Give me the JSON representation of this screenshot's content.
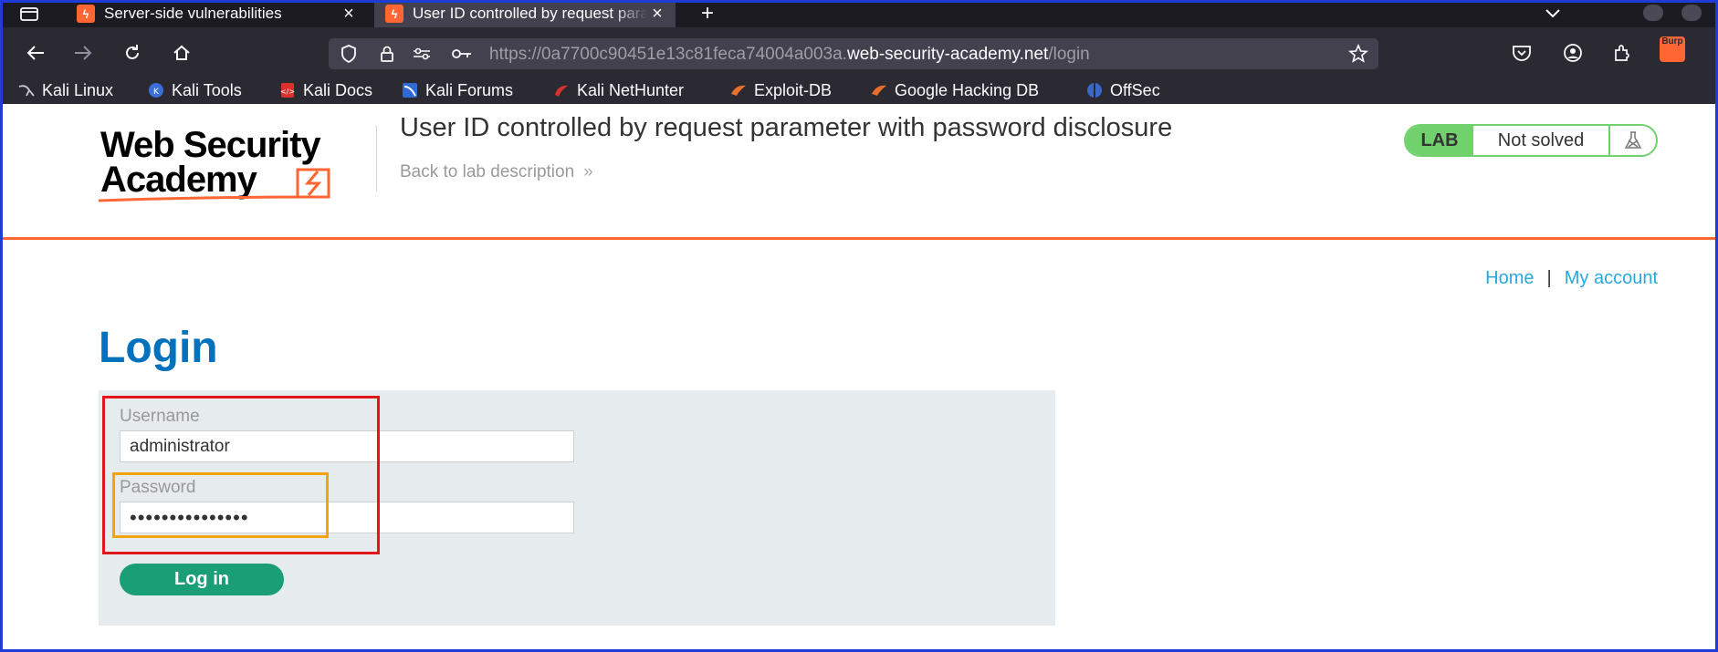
{
  "browser": {
    "tabs": [
      {
        "title": "Server-side vulnerabilities",
        "active": false
      },
      {
        "title": "User ID controlled by request parameter with password disclosure",
        "active": true
      }
    ],
    "url": {
      "prefix": "https://0a7700c90451e13c81feca74004a003a.",
      "host": "web-security-academy.net",
      "path": "/login"
    },
    "burp_label": "Burp",
    "bookmarks": [
      {
        "label": "Kali Linux",
        "icon": "kali-icon"
      },
      {
        "label": "Kali Tools",
        "icon": "kali-tools-icon"
      },
      {
        "label": "Kali Docs",
        "icon": "kali-docs-icon"
      },
      {
        "label": "Kali Forums",
        "icon": "kali-forums-icon"
      },
      {
        "label": "Kali NetHunter",
        "icon": "nethunter-icon"
      },
      {
        "label": "Exploit-DB",
        "icon": "exploit-db-icon"
      },
      {
        "label": "Google Hacking DB",
        "icon": "ghdb-icon"
      },
      {
        "label": "OffSec",
        "icon": "offsec-icon"
      }
    ]
  },
  "lab": {
    "logo_line1": "Web Security",
    "logo_line2": "Academy",
    "title": "User ID controlled by request parameter with password disclosure",
    "back_link": "Back to lab description",
    "badge": "LAB",
    "status": "Not solved"
  },
  "nav": {
    "home": "Home",
    "separator": "|",
    "my_account": "My account"
  },
  "login": {
    "heading": "Login",
    "username_label": "Username",
    "username_value": "administrator",
    "password_label": "Password",
    "password_value": "•••••••••••••••",
    "button": "Log in"
  },
  "colors": {
    "accent_orange": "#ff6633",
    "brand_blue": "#0071bc",
    "lab_green": "#70d16d",
    "button_green": "#1a9e76",
    "highlight_red": "#e3161b",
    "highlight_orange": "#f5a30c"
  }
}
